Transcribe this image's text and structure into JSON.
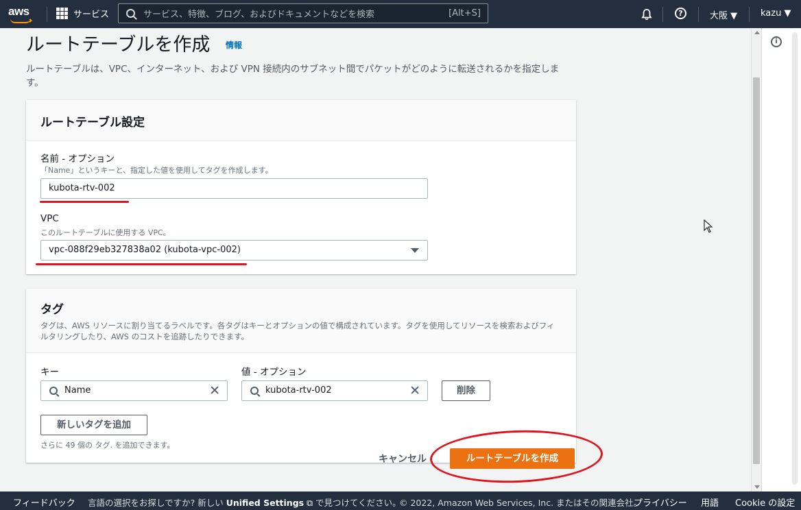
{
  "topnav": {
    "logo": "aws",
    "services_label": "サービス",
    "search_placeholder": "サービス、特徴、ブログ、およびドキュメントなどを検索",
    "search_shortcut": "[Alt+S]",
    "region": "大阪 ▼",
    "user": "kazu ▼"
  },
  "page": {
    "title": "ルートテーブルを作成",
    "info_link": "情報",
    "description": "ルートテーブルは、VPC、インターネット、および VPN 接続内のサブネット間でパケットがどのように転送されるかを指定します。"
  },
  "route_table_settings": {
    "heading": "ルートテーブル設定",
    "name_label": "名前 - オプション",
    "name_hint": "「Name」というキーと、指定した値を使用してタグを作成します。",
    "name_value": "kubota-rtv-002",
    "vpc_label": "VPC",
    "vpc_hint": "このルートテーブルに使用する VPC。",
    "vpc_value": "vpc-088f29eb327838a02 (kubota-vpc-002)"
  },
  "tags": {
    "heading": "タグ",
    "description": "タグは、AWS リソースに割り当てるラベルです。各タグはキーとオプションの値で構成されています。タグを使用してリソースを検索およびフィルタリングしたり、AWS のコストを追跡したりできます。",
    "key_label": "キー",
    "value_label": "値 - オプション",
    "key_value": "Name",
    "value_value": "kubota-rtv-002",
    "remove_button": "削除",
    "add_button": "新しいタグを追加",
    "remaining_note": "さらに 49 個の タグ. を追加できます。"
  },
  "actions": {
    "cancel": "キャンセル",
    "create": "ルートテーブルを作成"
  },
  "footer": {
    "feedback": "フィードバック",
    "language_prompt": "言語の選択をお探しですか? 新しい",
    "unified_settings": "Unified Settings",
    "language_suffix": "で見つけてください。",
    "copyright": "© 2022, Amazon Web Services, Inc. またはその関連会社。",
    "privacy": "プライバシー",
    "terms": "用語",
    "cookie": "Cookie の設定"
  },
  "colors": {
    "nav_bg": "#232f3e",
    "primary_button": "#ec7211",
    "link": "#0073bb",
    "annotation_red": "#e0141e"
  }
}
